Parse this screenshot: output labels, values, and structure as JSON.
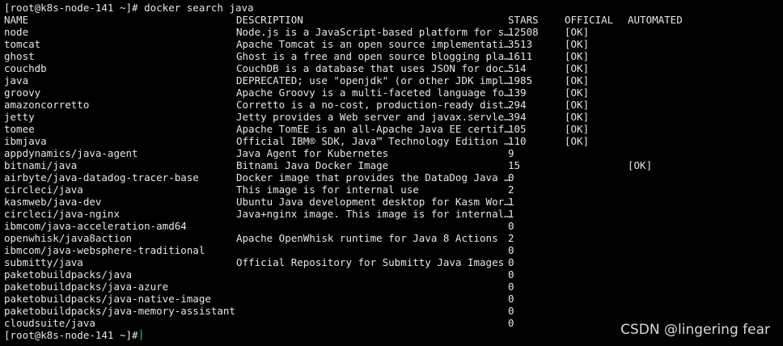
{
  "terminal": {
    "prompt": "[root@k8s-node-141 ~]# ",
    "command": "docker search java",
    "headers": {
      "name": "NAME",
      "description": "DESCRIPTION",
      "stars": "STARS",
      "official": "OFFICIAL",
      "automated": "AUTOMATED"
    },
    "rows": [
      {
        "name": "node",
        "description": "Node.js is a JavaScript-based platform for s…",
        "stars": "12508",
        "official": "[OK]",
        "automated": ""
      },
      {
        "name": "tomcat",
        "description": "Apache Tomcat is an open source implementati…",
        "stars": "3513",
        "official": "[OK]",
        "automated": ""
      },
      {
        "name": "ghost",
        "description": "Ghost is a free and open source blogging pla…",
        "stars": "1611",
        "official": "[OK]",
        "automated": ""
      },
      {
        "name": "couchdb",
        "description": "CouchDB is a database that uses JSON for doc…",
        "stars": "514",
        "official": "[OK]",
        "automated": ""
      },
      {
        "name": "java",
        "description": "DEPRECATED; use \"openjdk\" (or other JDK impl…",
        "stars": "1985",
        "official": "[OK]",
        "automated": ""
      },
      {
        "name": "groovy",
        "description": "Apache Groovy is a multi-faceted language fo…",
        "stars": "139",
        "official": "[OK]",
        "automated": ""
      },
      {
        "name": "amazoncorretto",
        "description": "Corretto is a no-cost, production-ready dist…",
        "stars": "294",
        "official": "[OK]",
        "automated": ""
      },
      {
        "name": "jetty",
        "description": "Jetty provides a Web server and javax.servle…",
        "stars": "394",
        "official": "[OK]",
        "automated": ""
      },
      {
        "name": "tomee",
        "description": "Apache TomEE is an all-Apache Java EE certif…",
        "stars": "105",
        "official": "[OK]",
        "automated": ""
      },
      {
        "name": "ibmjava",
        "description": "Official IBM® SDK, Java™ Technology Edition …",
        "stars": "110",
        "official": "[OK]",
        "automated": ""
      },
      {
        "name": "appdynamics/java-agent",
        "description": "Java Agent for Kubernetes",
        "stars": "9",
        "official": "",
        "automated": ""
      },
      {
        "name": "bitnami/java",
        "description": "Bitnami Java Docker Image",
        "stars": "15",
        "official": "",
        "automated": "[OK]"
      },
      {
        "name": "airbyte/java-datadog-tracer-base",
        "description": "Docker image that provides the DataDog Java …",
        "stars": "0",
        "official": "",
        "automated": ""
      },
      {
        "name": "circleci/java",
        "description": "This image is for internal use",
        "stars": "2",
        "official": "",
        "automated": ""
      },
      {
        "name": "kasmweb/java-dev",
        "description": "Ubuntu Java development desktop for Kasm Wor…",
        "stars": "1",
        "official": "",
        "automated": ""
      },
      {
        "name": "circleci/java-nginx",
        "description": "Java+nginx image. This image is for internal…",
        "stars": "1",
        "official": "",
        "automated": ""
      },
      {
        "name": "ibmcom/java-acceleration-amd64",
        "description": "",
        "stars": "0",
        "official": "",
        "automated": ""
      },
      {
        "name": "openwhisk/java8action",
        "description": "Apache OpenWhisk runtime for Java 8 Actions",
        "stars": "2",
        "official": "",
        "automated": ""
      },
      {
        "name": "ibmcom/java-websphere-traditional",
        "description": "",
        "stars": "0",
        "official": "",
        "automated": ""
      },
      {
        "name": "submitty/java",
        "description": "Official Repository for Submitty Java Images",
        "stars": "0",
        "official": "",
        "automated": ""
      },
      {
        "name": "paketobuildpacks/java",
        "description": "",
        "stars": "0",
        "official": "",
        "automated": ""
      },
      {
        "name": "paketobuildpacks/java-azure",
        "description": "",
        "stars": "0",
        "official": "",
        "automated": ""
      },
      {
        "name": "paketobuildpacks/java-native-image",
        "description": "",
        "stars": "0",
        "official": "",
        "automated": ""
      },
      {
        "name": "paketobuildpacks/java-memory-assistant",
        "description": "",
        "stars": "0",
        "official": "",
        "automated": ""
      },
      {
        "name": "cloudsuite/java",
        "description": "",
        "stars": "0",
        "official": "",
        "automated": ""
      }
    ],
    "final_prompt": "[root@k8s-node-141 ~]#"
  },
  "watermark": "CSDN @lingering fear",
  "colors": {
    "background": "#000000",
    "text": "#e6e6e6",
    "cursor": "#2fd14b"
  }
}
